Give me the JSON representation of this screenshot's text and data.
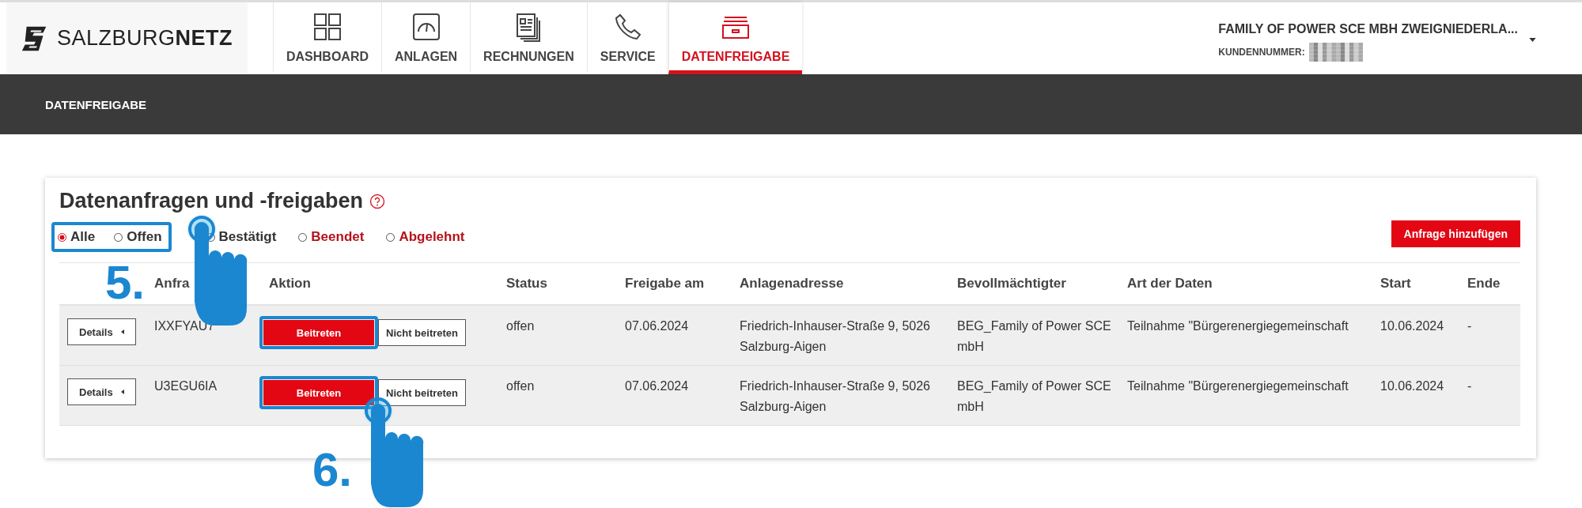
{
  "header": {
    "logo": "SALZBURG**NETZ**",
    "tabs": [
      {
        "label": "DASHBOARD",
        "selected": false
      },
      {
        "label": "ANLAGEN",
        "selected": false
      },
      {
        "label": "RECHNUNGEN",
        "selected": false
      },
      {
        "label": "SERVICE",
        "selected": false
      },
      {
        "label": "DATENFREIGABE",
        "selected": true
      }
    ],
    "account": {
      "name": "FAMILY OF POWER SCE MBH ZWEIGNIEDERLA...",
      "customer_label": "KUNDENNUMMER:"
    }
  },
  "page_bar": {
    "title": "DATENFREIGABE"
  },
  "card": {
    "title": "Datenanfragen und -freigaben",
    "filters": [
      {
        "label": "Alle",
        "selected": true,
        "highlighted": true,
        "color": "#333333"
      },
      {
        "label": "Offen",
        "selected": false,
        "highlighted": true,
        "color": "#333333"
      },
      {
        "label": "Bestätigt",
        "selected": false,
        "highlighted": false,
        "color": "#333333"
      },
      {
        "label": "Beendet",
        "selected": false,
        "highlighted": false,
        "color": "#b5121b"
      },
      {
        "label": "Abgelehnt",
        "selected": false,
        "highlighted": false,
        "color": "#b5121b"
      }
    ],
    "add_button": "Anfrage hinzufügen",
    "table": {
      "columns": [
        "",
        "Anfra",
        "Aktion",
        "Status",
        "Freigabe am",
        "Anlagenadresse",
        "Bevollmächtigter",
        "Art der Daten",
        "Start",
        "Ende"
      ],
      "rows": [
        {
          "details": "Details",
          "id": "IXXFYAU7",
          "join": "Beitreten",
          "join_highlighted": true,
          "decline": "Nicht beitreten",
          "status": "offen",
          "released": "07.06.2024",
          "address": "Friedrich-Inhauser-Straße 9, 5026 Salzburg-Aigen",
          "agent": "BEG_Family of Power SCE mbH",
          "data_type": "Teilnahme \"Bürgerenergiegemeinschaft",
          "start": "10.06.2024",
          "end": "-"
        },
        {
          "details": "Details",
          "id": "U3EGU6IA",
          "join": "Beitreten",
          "join_highlighted": true,
          "decline": "Nicht beitreten",
          "status": "offen",
          "released": "07.06.2024",
          "address": "Friedrich-Inhauser-Straße 9, 5026 Salzburg-Aigen",
          "agent": "BEG_Family of Power SCE mbH",
          "data_type": "Teilnahme \"Bürgerenergiegemeinschaft",
          "start": "10.06.2024",
          "end": "-"
        }
      ]
    }
  },
  "annotations": [
    {
      "label": "5."
    },
    {
      "label": "6."
    }
  ]
}
